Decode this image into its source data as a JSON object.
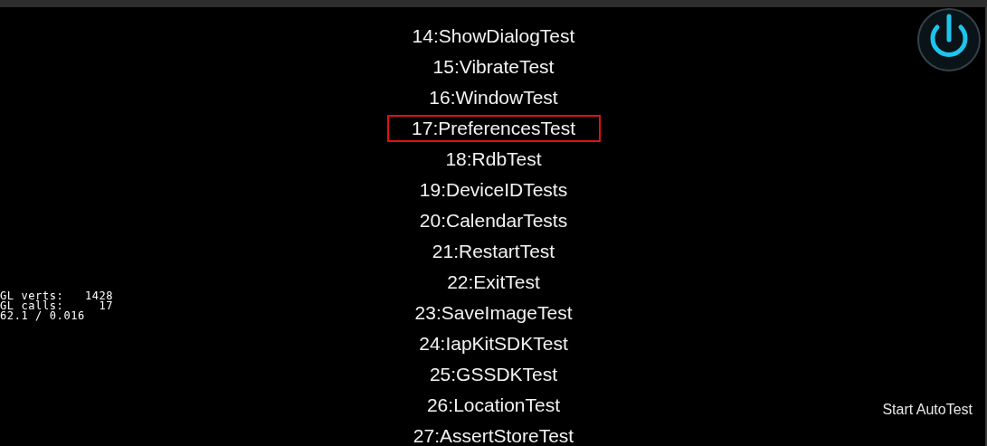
{
  "tests": [
    {
      "label": "14:ShowDialogTest",
      "selected": false
    },
    {
      "label": "15:VibrateTest",
      "selected": false
    },
    {
      "label": "16:WindowTest",
      "selected": false
    },
    {
      "label": "17:PreferencesTest",
      "selected": true
    },
    {
      "label": "18:RdbTest",
      "selected": false
    },
    {
      "label": "19:DeviceIDTests",
      "selected": false
    },
    {
      "label": "20:CalendarTests",
      "selected": false
    },
    {
      "label": "21:RestartTest",
      "selected": false
    },
    {
      "label": "22:ExitTest",
      "selected": false
    },
    {
      "label": "23:SaveImageTest",
      "selected": false
    },
    {
      "label": "24:IapKitSDKTest",
      "selected": false
    },
    {
      "label": "25:GSSDKTest",
      "selected": false
    },
    {
      "label": "26:LocationTest",
      "selected": false
    },
    {
      "label": "27:AssertStoreTest",
      "selected": false
    }
  ],
  "stats": [
    "GL verts:   1428",
    "GL calls:     17",
    "62.1 / 0.016"
  ],
  "auto_test_button": "Start AutoTest"
}
